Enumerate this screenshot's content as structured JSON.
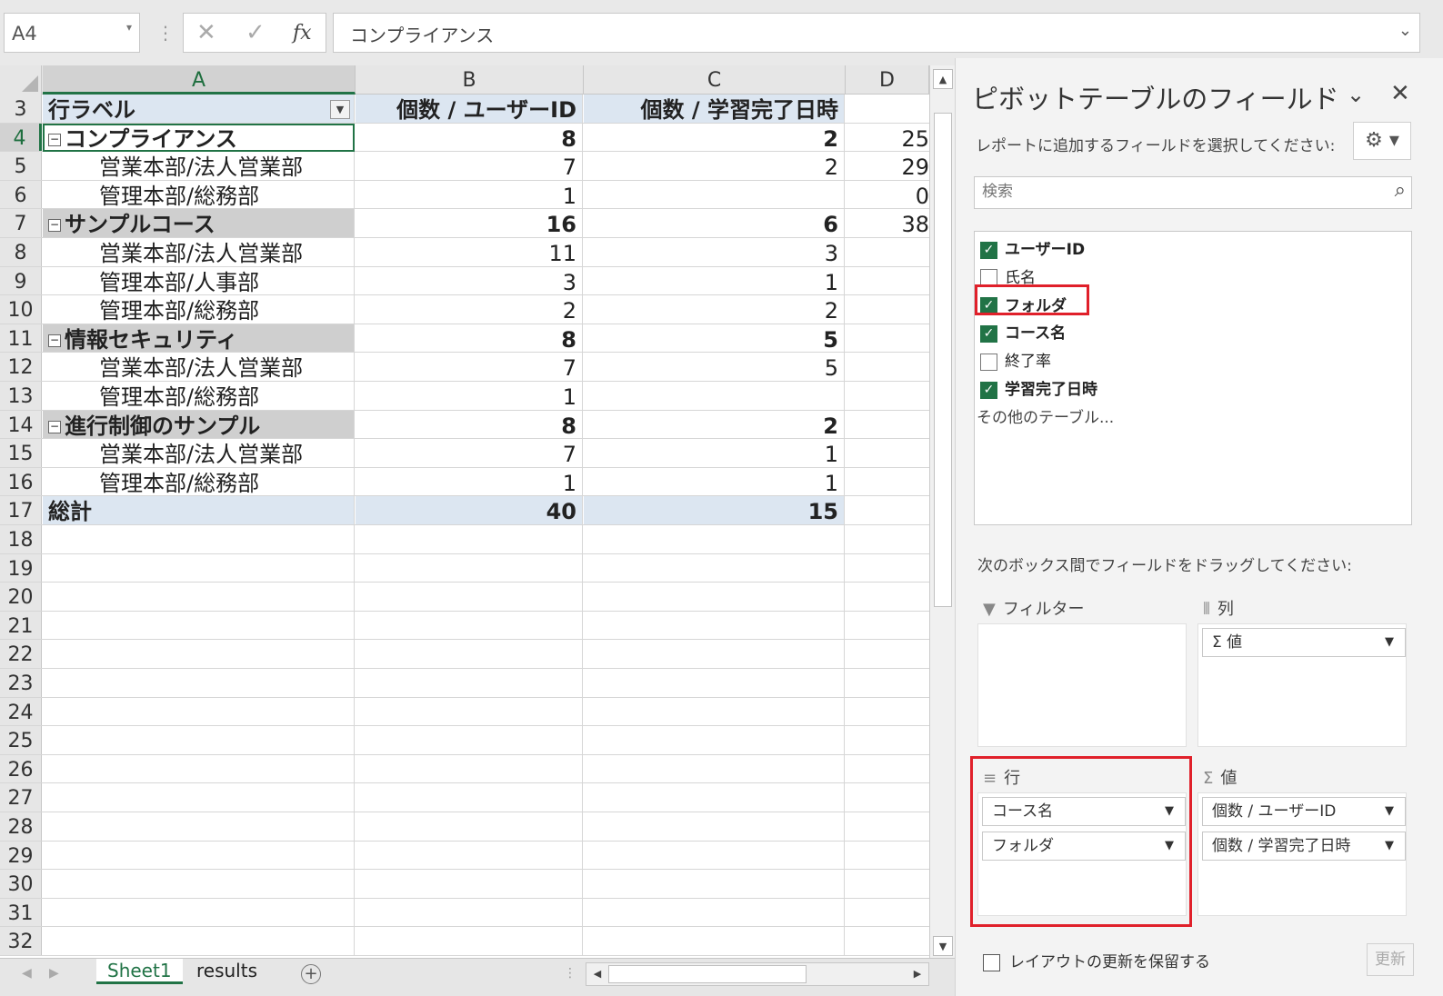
{
  "formula_bar": {
    "name_box": "A4",
    "cancel_glyph": "✕",
    "enter_glyph": "✓",
    "fx_label": "fx",
    "formula": "コンプライアンス"
  },
  "columns": [
    "A",
    "B",
    "C",
    "D"
  ],
  "rows": [
    {
      "n": "3",
      "a": "行ラベル",
      "b": "個数 / ユーザーID",
      "c": "個数 / 学習完了日時",
      "d": ""
    },
    {
      "n": "4",
      "a": "コンプライアンス",
      "b": "8",
      "c": "2",
      "d": "25"
    },
    {
      "n": "5",
      "a": "営業本部/法人営業部",
      "b": "7",
      "c": "2",
      "d": "29"
    },
    {
      "n": "6",
      "a": "管理本部/総務部",
      "b": "1",
      "c": "",
      "d": "0"
    },
    {
      "n": "7",
      "a": "サンプルコース",
      "b": "16",
      "c": "6",
      "d": "38"
    },
    {
      "n": "8",
      "a": "営業本部/法人営業部",
      "b": "11",
      "c": "3",
      "d": ""
    },
    {
      "n": "9",
      "a": "管理本部/人事部",
      "b": "3",
      "c": "1",
      "d": ""
    },
    {
      "n": "10",
      "a": "管理本部/総務部",
      "b": "2",
      "c": "2",
      "d": ""
    },
    {
      "n": "11",
      "a": "情報セキュリティ",
      "b": "8",
      "c": "5",
      "d": ""
    },
    {
      "n": "12",
      "a": "営業本部/法人営業部",
      "b": "7",
      "c": "5",
      "d": ""
    },
    {
      "n": "13",
      "a": "管理本部/総務部",
      "b": "1",
      "c": "",
      "d": ""
    },
    {
      "n": "14",
      "a": "進行制御のサンプル",
      "b": "8",
      "c": "2",
      "d": ""
    },
    {
      "n": "15",
      "a": "営業本部/法人営業部",
      "b": "7",
      "c": "1",
      "d": ""
    },
    {
      "n": "16",
      "a": "管理本部/総務部",
      "b": "1",
      "c": "1",
      "d": ""
    },
    {
      "n": "17",
      "a": "総計",
      "b": "40",
      "c": "15",
      "d": ""
    },
    {
      "n": "18",
      "a": "",
      "b": "",
      "c": "",
      "d": ""
    },
    {
      "n": "19",
      "a": "",
      "b": "",
      "c": "",
      "d": ""
    },
    {
      "n": "20",
      "a": "",
      "b": "",
      "c": "",
      "d": ""
    },
    {
      "n": "21",
      "a": "",
      "b": "",
      "c": "",
      "d": ""
    },
    {
      "n": "22",
      "a": "",
      "b": "",
      "c": "",
      "d": ""
    },
    {
      "n": "23",
      "a": "",
      "b": "",
      "c": "",
      "d": ""
    },
    {
      "n": "24",
      "a": "",
      "b": "",
      "c": "",
      "d": ""
    },
    {
      "n": "25",
      "a": "",
      "b": "",
      "c": "",
      "d": ""
    },
    {
      "n": "26",
      "a": "",
      "b": "",
      "c": "",
      "d": ""
    },
    {
      "n": "27",
      "a": "",
      "b": "",
      "c": "",
      "d": ""
    },
    {
      "n": "28",
      "a": "",
      "b": "",
      "c": "",
      "d": ""
    },
    {
      "n": "29",
      "a": "",
      "b": "",
      "c": "",
      "d": ""
    },
    {
      "n": "30",
      "a": "",
      "b": "",
      "c": "",
      "d": ""
    },
    {
      "n": "31",
      "a": "",
      "b": "",
      "c": "",
      "d": ""
    },
    {
      "n": "32",
      "a": "",
      "b": "",
      "c": "",
      "d": ""
    }
  ],
  "sheet_tabs": [
    "Sheet1",
    "results"
  ],
  "add_sheet_glyph": "+",
  "pane": {
    "title": "ピボットテーブルのフィールド",
    "subtitle": "レポートに追加するフィールドを選択してください:",
    "search_placeholder": "検索",
    "fields": [
      {
        "label": "ユーザーID",
        "checked": true
      },
      {
        "label": "氏名",
        "checked": false
      },
      {
        "label": "フォルダ",
        "checked": true
      },
      {
        "label": "コース名",
        "checked": true
      },
      {
        "label": "終了率",
        "checked": false
      },
      {
        "label": "学習完了日時",
        "checked": true
      }
    ],
    "more_tables": "その他のテーブル...",
    "drag_hint": "次のボックス間でフィールドをドラッグしてください:",
    "areas": {
      "filter": {
        "label": "フィルター",
        "items": []
      },
      "columns": {
        "label": "列",
        "items": [
          "Σ 値"
        ]
      },
      "rows": {
        "label": "行",
        "items": [
          "コース名",
          "フォルダ"
        ]
      },
      "values": {
        "label": "値",
        "items": [
          "個数 / ユーザーID",
          "個数 / 学習完了日時"
        ]
      }
    },
    "defer_label": "レイアウトの更新を保留する",
    "update_label": "更新"
  },
  "icons": {
    "filter": "funnel-icon",
    "columns": "columns-icon",
    "rows": "rows-icon",
    "values": "sigma-icon",
    "gear": "gear-icon",
    "search": "search-icon"
  },
  "colors": {
    "accent": "#217346",
    "highlight": "#e0202a",
    "pivot_header": "#dce6f1",
    "group_row": "#cfcfcf"
  }
}
